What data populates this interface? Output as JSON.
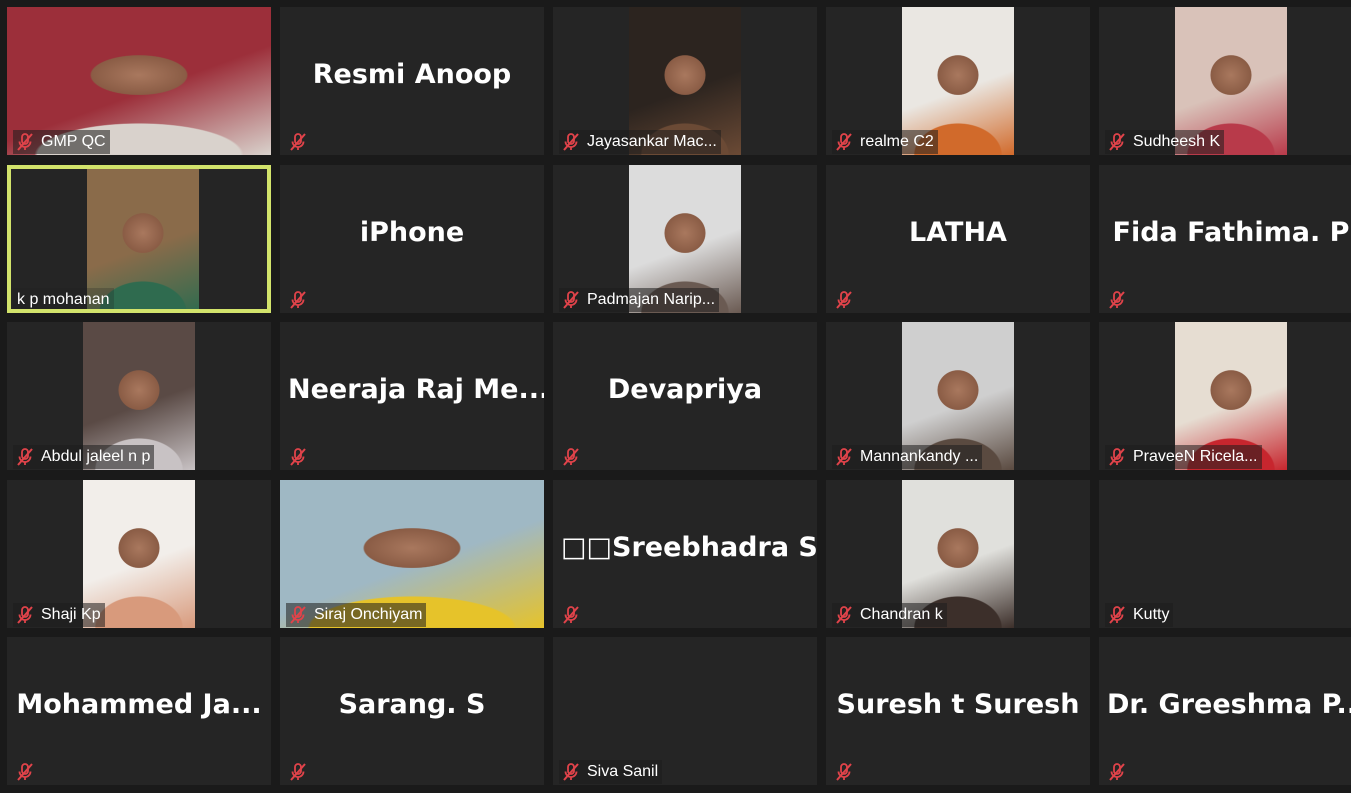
{
  "participants": [
    {
      "label": "GMP QC",
      "big_name": "",
      "video": "wide",
      "colors": [
        "#9c2f3a",
        "#d9d2cc"
      ],
      "active": false
    },
    {
      "label": "",
      "big_name": "Resmi Anoop",
      "video": "none",
      "colors": [],
      "active": false
    },
    {
      "label": "Jayasankar Mac...",
      "big_name": "",
      "video": "narrow",
      "colors": [
        "#2c241f",
        "#6b4a35"
      ],
      "active": false
    },
    {
      "label": "realme C2",
      "big_name": "",
      "video": "narrow",
      "colors": [
        "#eae7e2",
        "#d16a2b"
      ],
      "active": false
    },
    {
      "label": "Sudheesh K",
      "big_name": "",
      "video": "narrow",
      "colors": [
        "#d9c2b9",
        "#b83a4a"
      ],
      "active": false
    },
    {
      "label": "k p mohanan",
      "big_name": "",
      "video": "narrow",
      "colors": [
        "#8a6b4a",
        "#2f6b4f"
      ],
      "active": true
    },
    {
      "label": "",
      "big_name": "iPhone",
      "video": "none",
      "colors": [],
      "active": false
    },
    {
      "label": "Padmajan Narip...",
      "big_name": "",
      "video": "narrow",
      "colors": [
        "#dcdcdc",
        "#6a5a52"
      ],
      "active": false
    },
    {
      "label": "",
      "big_name": "LATHA",
      "video": "none",
      "colors": [],
      "active": false
    },
    {
      "label": "",
      "big_name": "Fida Fathima. P",
      "video": "none",
      "colors": [],
      "active": false
    },
    {
      "label": "Abdul jaleel n p",
      "big_name": "",
      "video": "narrow",
      "colors": [
        "#5a4a45",
        "#c8c2c4"
      ],
      "active": false
    },
    {
      "label": "",
      "big_name": "Neeraja  Raj  Me...",
      "video": "none",
      "colors": [],
      "active": false
    },
    {
      "label": "",
      "big_name": "Devapriya",
      "video": "none",
      "colors": [],
      "active": false
    },
    {
      "label": "Mannankandy ...",
      "big_name": "",
      "video": "narrow",
      "colors": [
        "#cfcfcf",
        "#5a4a40"
      ],
      "active": false
    },
    {
      "label": "PraveeN Ricela...",
      "big_name": "",
      "video": "narrow",
      "colors": [
        "#e6ddd2",
        "#c7262e"
      ],
      "active": false
    },
    {
      "label": "Shaji Kp",
      "big_name": "",
      "video": "narrow",
      "colors": [
        "#f2eeea",
        "#d89a7c"
      ],
      "active": false
    },
    {
      "label": "Siraj Onchiyam",
      "big_name": "",
      "video": "wide",
      "colors": [
        "#9fb8c4",
        "#e6c32a"
      ],
      "active": false
    },
    {
      "label": "",
      "big_name": "□□Sreebhadra  S...",
      "video": "none",
      "colors": [],
      "active": false
    },
    {
      "label": "Chandran k",
      "big_name": "",
      "video": "narrow",
      "colors": [
        "#e0e0dc",
        "#3c2f2a"
      ],
      "active": false
    },
    {
      "label": "Kutty",
      "big_name": "",
      "video": "none",
      "colors": [],
      "active": false
    },
    {
      "label": "",
      "big_name": "Mohammed  Ja...",
      "video": "none",
      "colors": [],
      "active": false
    },
    {
      "label": "",
      "big_name": "Sarang. S",
      "video": "none",
      "colors": [],
      "active": false
    },
    {
      "label": "Siva Sanil",
      "big_name": "",
      "video": "none",
      "colors": [],
      "active": false
    },
    {
      "label": "",
      "big_name": "Suresh t Suresh",
      "video": "none",
      "colors": [],
      "active": false
    },
    {
      "label": "",
      "big_name": "Dr.  Greeshma  P...",
      "video": "none",
      "colors": [],
      "active": false
    }
  ],
  "theme": {
    "background": "#1a1a1a",
    "tile": "#252525",
    "active_border": "#d2e36b",
    "mic_muted": "#e0434a"
  }
}
